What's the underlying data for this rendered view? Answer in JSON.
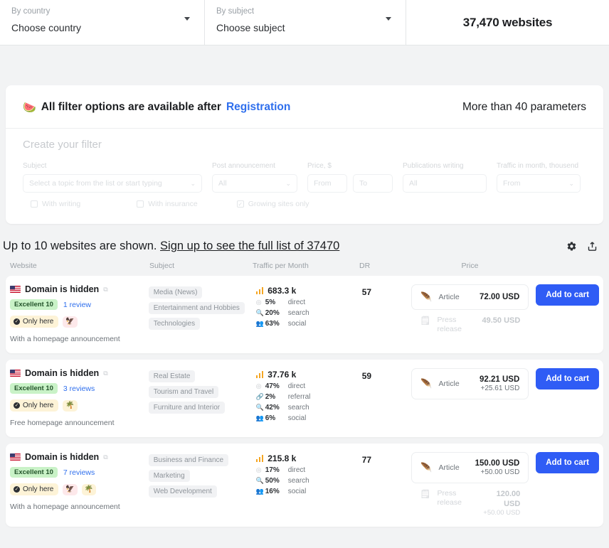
{
  "topbar": {
    "country": {
      "label": "By country",
      "value": "Choose country"
    },
    "subject": {
      "label": "By subject",
      "value": "Choose subject"
    },
    "count": "37,470 websites"
  },
  "filter": {
    "emoji": "🍉",
    "title": "All filter options are available after",
    "link": "Registration",
    "params_note": "More than 40 parameters",
    "create_title": "Create your filter",
    "fields": {
      "subject_label": "Subject",
      "subject_placeholder": "Select a topic from the list or start typing",
      "post_label": "Post announcement",
      "post_value": "All",
      "price_label": "Price, $",
      "price_from": "From",
      "price_to": "To",
      "pub_label": "Publications writing",
      "pub_value": "All",
      "traffic_label": "Traffic in month, thousend",
      "traffic_value": "From"
    },
    "checks": {
      "writing": "With writing",
      "insurance": "With insurance",
      "growing": "Growing sites only"
    }
  },
  "results": {
    "headline_prefix": "Up to 10 websites are shown. ",
    "headline_link": "Sign up to see the full list of 37470",
    "columns": {
      "website": "Website",
      "subject": "Subject",
      "traffic": "Traffic per Month",
      "dr": "DR",
      "price": "Price"
    },
    "icons": {
      "settings": "gear-icon",
      "export": "export-icon"
    },
    "add_to_cart": "Add to cart",
    "rows": [
      {
        "domain": "Domain is hidden",
        "rating": "Excellent 10",
        "reviews": "1 review",
        "only_here": "Only here",
        "chips": [
          "🦅"
        ],
        "note": "With a homepage announcement",
        "tags": [
          "Media (News)",
          "Entertainment and Hobbies",
          "Technologies"
        ],
        "traffic": "683.3 k",
        "sources": [
          {
            "pct": "5%",
            "name": "direct"
          },
          {
            "pct": "20%",
            "name": "search"
          },
          {
            "pct": "63%",
            "name": "social"
          }
        ],
        "dr": "57",
        "primary": {
          "type": "Article",
          "amount": "72.00 USD",
          "extra": ""
        },
        "secondary": {
          "type": "Press release",
          "amount": "49.50 USD",
          "extra": ""
        }
      },
      {
        "domain": "Domain is hidden",
        "rating": "Excellent 10",
        "reviews": "3 reviews",
        "only_here": "Only here",
        "chips": [
          "🌴"
        ],
        "note": "Free homepage announcement",
        "tags": [
          "Real Estate",
          "Tourism and Travel",
          "Furniture and Interior"
        ],
        "traffic": "37.76 k",
        "sources": [
          {
            "pct": "47%",
            "name": "direct"
          },
          {
            "pct": "2%",
            "name": "referral"
          },
          {
            "pct": "42%",
            "name": "search"
          },
          {
            "pct": "6%",
            "name": "social"
          }
        ],
        "dr": "59",
        "primary": {
          "type": "Article",
          "amount": "92.21 USD",
          "extra": "+25.61 USD"
        },
        "secondary": null
      },
      {
        "domain": "Domain is hidden",
        "rating": "Excellent 10",
        "reviews": "7 reviews",
        "only_here": "Only here",
        "chips": [
          "🦅",
          "🌴"
        ],
        "note": "With a homepage announcement",
        "tags": [
          "Business and Finance",
          "Marketing",
          "Web Development"
        ],
        "traffic": "215.8 k",
        "sources": [
          {
            "pct": "17%",
            "name": "direct"
          },
          {
            "pct": "50%",
            "name": "search"
          },
          {
            "pct": "16%",
            "name": "social"
          }
        ],
        "dr": "77",
        "primary": {
          "type": "Article",
          "amount": "150.00 USD",
          "extra": "+50.00 USD"
        },
        "secondary": {
          "type": "Press release",
          "amount": "120.00 USD",
          "extra": "+50.00 USD"
        }
      }
    ]
  }
}
